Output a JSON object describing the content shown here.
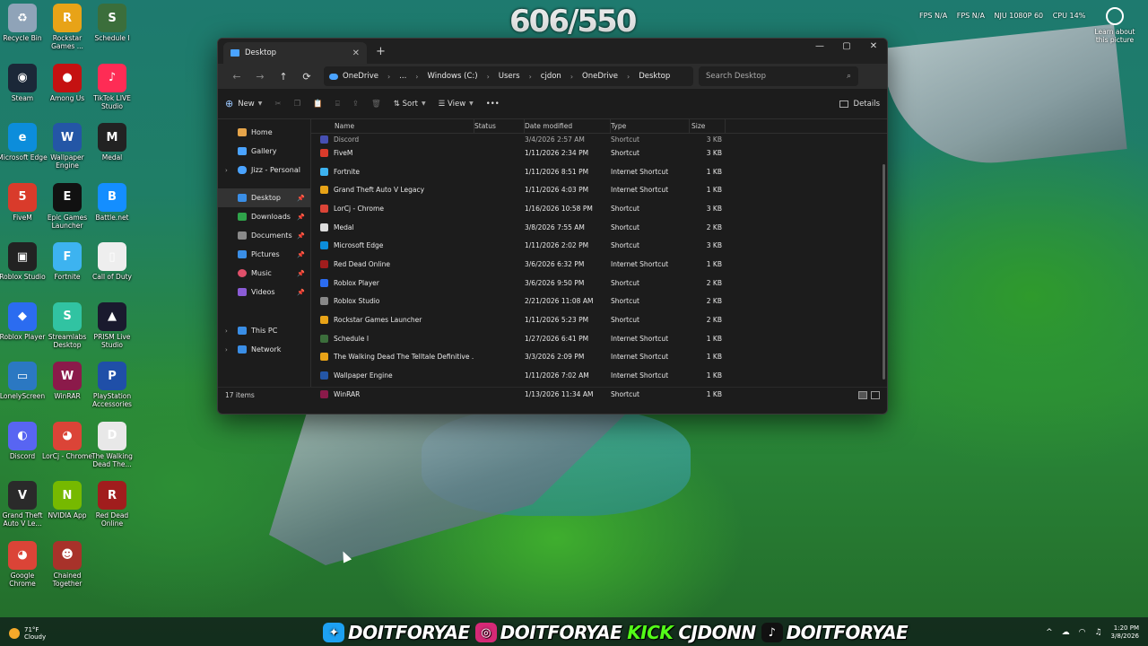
{
  "overlay": {
    "counter": "606/550",
    "stats": [
      "FPS N/A",
      "FPS N/A",
      "NJU 1080P 60",
      "CPU 14%"
    ],
    "learn_about": "Learn about this picture"
  },
  "desktop_icons": [
    {
      "label": "Recycle Bin",
      "color": "#8fa3b8",
      "glyph": "♻"
    },
    {
      "label": "Rockstar Games ...",
      "color": "#e8a317",
      "glyph": "R"
    },
    {
      "label": "Schedule I",
      "color": "#3b6e3b",
      "glyph": "S"
    },
    {
      "label": "Steam",
      "color": "#1b2838",
      "glyph": "◉"
    },
    {
      "label": "Among Us",
      "color": "#c51111",
      "glyph": "●"
    },
    {
      "label": "TikTok LIVE Studio",
      "color": "#fe2c55",
      "glyph": "♪"
    },
    {
      "label": "Microsoft Edge",
      "color": "#0c8ddb",
      "glyph": "e"
    },
    {
      "label": "Wallpaper Engine",
      "color": "#2456a6",
      "glyph": "W"
    },
    {
      "label": "Medal",
      "color": "#222222",
      "glyph": "M"
    },
    {
      "label": "FiveM",
      "color": "#d93b2b",
      "glyph": "5"
    },
    {
      "label": "Epic Games Launcher",
      "color": "#111111",
      "glyph": "E"
    },
    {
      "label": "Battle.net",
      "color": "#148eff",
      "glyph": "B"
    },
    {
      "label": "Roblox Studio",
      "color": "#222222",
      "glyph": "▣"
    },
    {
      "label": "Fortnite",
      "color": "#3db3f0",
      "glyph": "F"
    },
    {
      "label": "Call of Duty",
      "color": "#eeeeee",
      "glyph": "▯"
    },
    {
      "label": "Roblox Player",
      "color": "#2b6cf0",
      "glyph": "◆"
    },
    {
      "label": "Streamlabs Desktop",
      "color": "#31c3a2",
      "glyph": "S"
    },
    {
      "label": "PRISM Live Studio",
      "color": "#1a1a2e",
      "glyph": "▲"
    },
    {
      "label": "LonelyScreen",
      "color": "#2b78c2",
      "glyph": "▭"
    },
    {
      "label": "WinRAR",
      "color": "#8b1a4a",
      "glyph": "W"
    },
    {
      "label": "PlayStation Accessories",
      "color": "#1f4fa8",
      "glyph": "P"
    },
    {
      "label": "Discord",
      "color": "#5865f2",
      "glyph": "◐"
    },
    {
      "label": "LorCj - Chrome",
      "color": "#db4437",
      "glyph": "◕"
    },
    {
      "label": "The Walking Dead The...",
      "color": "#e8e8e8",
      "glyph": "D"
    },
    {
      "label": "Grand Theft Auto V Le...",
      "color": "#2a2a2a",
      "glyph": "V"
    },
    {
      "label": "NVIDIA App",
      "color": "#76b900",
      "glyph": "N"
    },
    {
      "label": "Red Dead Online",
      "color": "#a11d1d",
      "glyph": "R"
    },
    {
      "label": "Google Chrome",
      "color": "#db4437",
      "glyph": "◕"
    },
    {
      "label": "Chained Together",
      "color": "#a8322a",
      "glyph": "☻"
    }
  ],
  "window": {
    "tab_title": "Desktop",
    "breadcrumb": [
      "OneDrive",
      "...",
      "Windows (C:)",
      "Users",
      "cjdon",
      "OneDrive",
      "Desktop"
    ],
    "search_placeholder": "Search Desktop",
    "toolbar": {
      "new": "New",
      "sort": "Sort",
      "view": "View",
      "more": "•••",
      "details": "Details"
    },
    "nav": {
      "home": "Home",
      "gallery": "Gallery",
      "personal": "Jizz - Personal",
      "desktop": "Desktop",
      "downloads": "Downloads",
      "documents": "Documents",
      "pictures": "Pictures",
      "music": "Music",
      "videos": "Videos",
      "this_pc": "This PC",
      "network": "Network"
    },
    "columns": {
      "name": "Name",
      "status": "Status",
      "date": "Date modified",
      "type": "Type",
      "size": "Size"
    },
    "partial_row": {
      "name": "Discord",
      "date": "3/4/2026 2:57 AM",
      "type": "Shortcut",
      "size": "3 KB"
    },
    "files": [
      {
        "name": "FiveM",
        "date": "1/11/2026 2:34 PM",
        "type": "Shortcut",
        "size": "3 KB",
        "color": "#d93b2b"
      },
      {
        "name": "Fortnite",
        "date": "1/11/2026 8:51 PM",
        "type": "Internet Shortcut",
        "size": "1 KB",
        "color": "#3db3f0"
      },
      {
        "name": "Grand Theft Auto V Legacy",
        "date": "1/11/2026 4:03 PM",
        "type": "Internet Shortcut",
        "size": "1 KB",
        "color": "#e8a317"
      },
      {
        "name": "LorCj - Chrome",
        "date": "1/16/2026 10:58 PM",
        "type": "Shortcut",
        "size": "3 KB",
        "color": "#db4437"
      },
      {
        "name": "Medal",
        "date": "3/8/2026 7:55 AM",
        "type": "Shortcut",
        "size": "2 KB",
        "color": "#dddddd"
      },
      {
        "name": "Microsoft Edge",
        "date": "1/11/2026 2:02 PM",
        "type": "Shortcut",
        "size": "3 KB",
        "color": "#0c8ddb"
      },
      {
        "name": "Red Dead Online",
        "date": "3/6/2026 6:32 PM",
        "type": "Internet Shortcut",
        "size": "1 KB",
        "color": "#a11d1d"
      },
      {
        "name": "Roblox Player",
        "date": "3/6/2026 9:50 PM",
        "type": "Shortcut",
        "size": "2 KB",
        "color": "#2b6cf0"
      },
      {
        "name": "Roblox Studio",
        "date": "2/21/2026 11:08 AM",
        "type": "Shortcut",
        "size": "2 KB",
        "color": "#888888"
      },
      {
        "name": "Rockstar Games Launcher",
        "date": "1/11/2026 5:23 PM",
        "type": "Shortcut",
        "size": "2 KB",
        "color": "#e8a317"
      },
      {
        "name": "Schedule I",
        "date": "1/27/2026 6:41 PM",
        "type": "Internet Shortcut",
        "size": "1 KB",
        "color": "#3b6e3b"
      },
      {
        "name": "The Walking Dead The Telltale Definitive ...",
        "date": "3/3/2026 2:09 PM",
        "type": "Internet Shortcut",
        "size": "1 KB",
        "color": "#e8a317"
      },
      {
        "name": "Wallpaper Engine",
        "date": "1/11/2026 7:02 AM",
        "type": "Internet Shortcut",
        "size": "1 KB",
        "color": "#2456a6"
      },
      {
        "name": "WinRAR",
        "date": "1/13/2026 11:34 AM",
        "type": "Shortcut",
        "size": "1 KB",
        "color": "#8b1a4a"
      }
    ],
    "item_count": "17 items"
  },
  "taskbar": {
    "weather_temp": "71°F",
    "weather_cond": "Cloudy",
    "time": "1:20 PM",
    "date": "3/8/2026"
  },
  "socials": [
    {
      "handle": "DOITFORYAE",
      "icon": "twitter",
      "color": "#1da1f2",
      "glyph": "🐦"
    },
    {
      "handle": "DOITFORYAE",
      "icon": "instagram",
      "color": "#d62976",
      "glyph": "◎"
    },
    {
      "handle": "CJDONN",
      "icon": "kick",
      "prefix": "KICK"
    },
    {
      "handle": "DOITFORYAE",
      "icon": "tiktok",
      "color": "#111111",
      "glyph": "♪"
    }
  ]
}
